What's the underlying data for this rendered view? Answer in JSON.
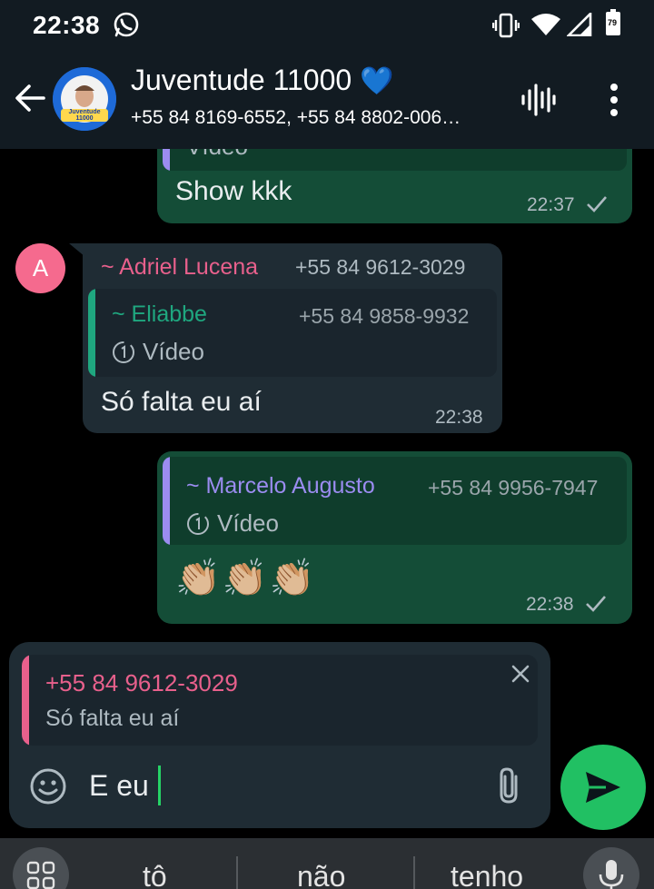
{
  "status_bar": {
    "time": "22:38",
    "battery": "79"
  },
  "header": {
    "title": "Juventude 11000",
    "title_emoji": "💙",
    "avatar_text": "Juventude 11000",
    "participants": "+55 84 8169-6552, +55 84 8802-006…"
  },
  "messages": [
    {
      "id": "m1",
      "quoted_media": "Vídeo",
      "text": "Show kkk",
      "time": "22:37"
    },
    {
      "id": "m2",
      "avatar_letter": "A",
      "sender_name": "~ Adriel Lucena",
      "sender_phone": "+55 84 9612-3029",
      "quoted_name": "~ Eliabbe",
      "quoted_phone": "+55 84 9858-9932",
      "quoted_media": "Vídeo",
      "text": "Só falta eu aí",
      "time": "22:38"
    },
    {
      "id": "m3",
      "quoted_name": "~ Marcelo Augusto",
      "quoted_phone": "+55 84 9956-7947",
      "quoted_media": "Vídeo",
      "text": "👏🏼👏🏼👏🏼",
      "time": "22:38"
    }
  ],
  "composer": {
    "reply_phone": "+55 84 9612-3029",
    "reply_text": "Só falta eu aí",
    "input_value": "E eu"
  },
  "keyboard": {
    "suggestions": [
      "tô",
      "não",
      "tenho"
    ]
  },
  "colors": {
    "outgoing_bubble": "#144d37",
    "incoming_bubble": "#1f2c34",
    "send_button": "#21c063",
    "adriel_name": "#e8608c",
    "eliabbe_name": "#1fa77f",
    "marcelo_name": "#9b8cf0"
  }
}
